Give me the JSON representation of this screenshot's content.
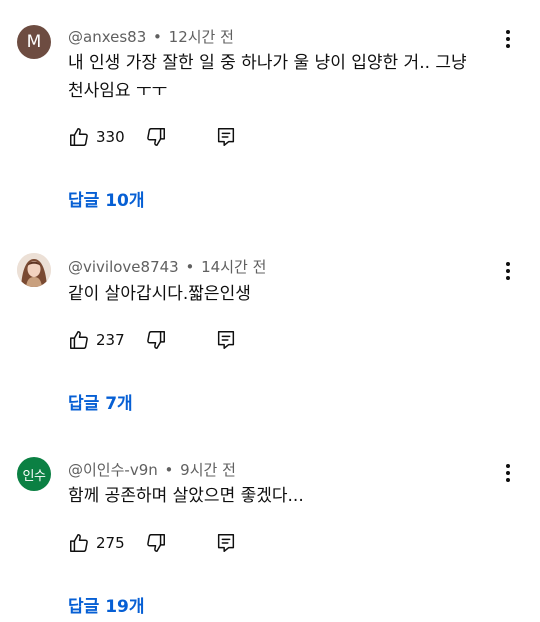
{
  "comments": [
    {
      "avatar_letter": "M",
      "author": "@anxes83",
      "time": "12시간 전",
      "text_line1": "내 인생 가장 잘한 일 중 하나가 울 냥이 입양한 거.. 그냥",
      "text_line2": "천사임요 ㅜㅜ",
      "likes": "330",
      "replies_label": "답글 10개",
      "colors": {
        "avatar": "#6d4c41"
      }
    },
    {
      "avatar_type": "photo",
      "author": "@vivilove8743",
      "time": "14시간 전",
      "text_line1": "같이 살아갑시다.짧은인생",
      "likes": "237",
      "replies_label": "답글 7개"
    },
    {
      "avatar_text": "인수",
      "author": "@이인수-v9n",
      "time": "9시간 전",
      "text_line1": "함께 공존하며 살았으면 좋겠다...",
      "likes": "275",
      "replies_label": "답글 19개",
      "colors": {
        "avatar": "#0b8043"
      }
    }
  ],
  "meta_separator": "•",
  "icons": {
    "like": "thumb-up-icon",
    "dislike": "thumb-down-icon",
    "reply": "reply-icon",
    "more": "more-vert-icon"
  },
  "colors": {
    "link": "#065fd4",
    "meta": "#606060",
    "text": "#0f0f0f"
  }
}
